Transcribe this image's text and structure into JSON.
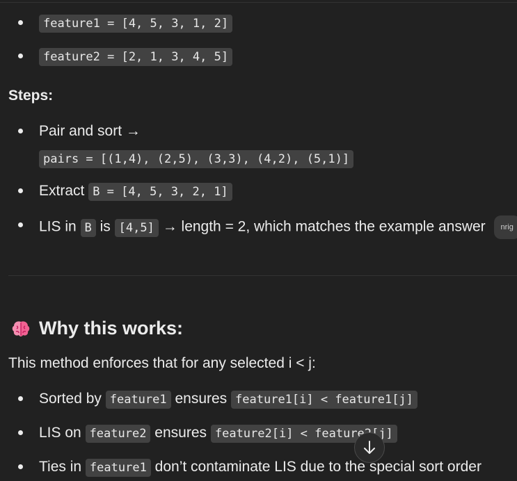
{
  "features": {
    "f1": "feature1 = [4, 5, 3, 1, 2]",
    "f2": "feature2 = [2, 1, 3, 4, 5]"
  },
  "steps": {
    "heading": "Steps:",
    "pair_label": "Pair and sort →",
    "pairs_code": "pairs = [(1,4), (2,5), (3,3), (4,2), (5,1)]",
    "extract_label": "Extract",
    "extract_code": "B = [4, 5, 3, 2, 1]",
    "lis_label1": "LIS in",
    "lis_code1": "B",
    "lis_label2": "is",
    "lis_code2": "[4,5]",
    "lis_label3": "→ length = 2, which matches the example answer",
    "citation": "nrig"
  },
  "why": {
    "heading": "Why this works:",
    "intro": "This method enforces that for any selected i < j:",
    "b1_pre": "Sorted by",
    "b1_code1": "feature1",
    "b1_mid": "ensures",
    "b1_code2": "feature1[i] < feature1[j]",
    "b2_pre": "LIS on",
    "b2_code1": "feature2",
    "b2_mid": "ensures",
    "b2_code2": "feature2[i] < feature2[j]",
    "b3_pre": "Ties in",
    "b3_code1": "feature1",
    "b3_post": "don’t contaminate LIS due to the special sort order"
  },
  "icons": {
    "brain": "brain-emoji-icon",
    "scroll": "arrow-down-icon"
  }
}
